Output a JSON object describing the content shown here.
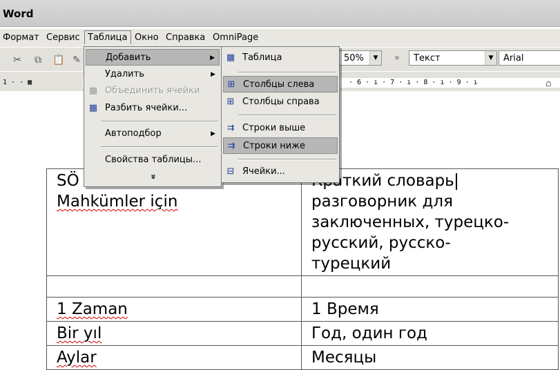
{
  "title": "Word",
  "menubar": [
    "Формат",
    "Сервис",
    "Таблица",
    "Окно",
    "Справка",
    "OmniPage"
  ],
  "toolbar": {
    "zoom": "50%",
    "style": "Текст",
    "font": "Arial"
  },
  "ruler": {
    "left_marks": "1 · · ▦",
    "right_marks": "· 6 · ı · 7 · ı · 8 · ı · 9 · ı"
  },
  "table_menu": {
    "items": [
      {
        "label": "Добавить",
        "submenu": true,
        "highlighted": true
      },
      {
        "label": "Удалить",
        "submenu": true
      },
      {
        "label": "Объединить ячейки",
        "disabled": true,
        "icon": "merge-cells-icon"
      },
      {
        "label": "Разбить ячейки...",
        "icon": "split-cells-icon"
      },
      {
        "label": "Автоподбор",
        "submenu": true
      },
      {
        "label": "Свойства таблицы..."
      }
    ],
    "expand": "»"
  },
  "insert_submenu": {
    "items": [
      {
        "label": "Таблица",
        "icon": "table-icon"
      },
      {
        "label": "Столбцы слева",
        "icon": "columns-left-icon",
        "highlighted": true
      },
      {
        "label": "Столбцы справа",
        "icon": "columns-right-icon"
      },
      {
        "label": "Строки выше",
        "icon": "rows-above-icon"
      },
      {
        "label": "Строки ниже",
        "icon": "rows-below-icon",
        "highlighted": true
      },
      {
        "label": "Ячейки...",
        "icon": "cells-icon"
      }
    ]
  },
  "document_table": {
    "rows": [
      [
        "SÖ",
        "Краткий словарь"
      ],
      [
        "Mahkümler için",
        "разговорник для заключенных, турецко-русский, русско-турецкий"
      ],
      [
        "",
        ""
      ],
      [
        "1 Zaman",
        "1 Время"
      ],
      [
        "Bir yıl",
        "Год, один год"
      ],
      [
        "Aylar",
        "Месяцы"
      ]
    ]
  }
}
